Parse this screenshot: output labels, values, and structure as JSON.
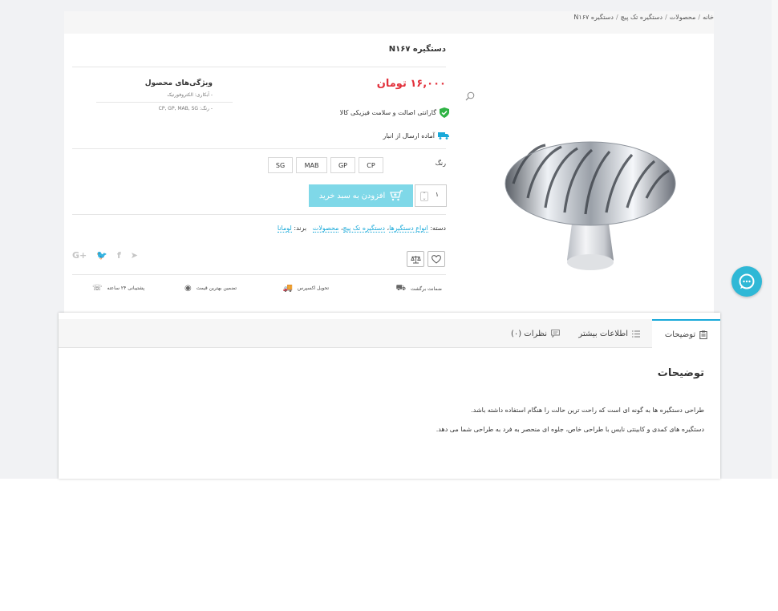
{
  "breadcrumb": {
    "items": [
      "خانه",
      "محصولات",
      "دستگیره تک پیچ",
      "دستگیره N۱۶۷"
    ],
    "separator": "/"
  },
  "product": {
    "title": "دستگیره N۱۶۷",
    "price": "۱۶,۰۰۰ تومان",
    "guarantee": "گارانتی اصالت و سلامت فیزیکی کالا",
    "ready": "آماده ارسال از انبار",
    "color_label": "رنگ",
    "colors": [
      "CP",
      "GP",
      "MAB",
      "SG"
    ],
    "quantity": "۱",
    "add_to_cart": "افزودن به سبد خرید",
    "category_label": "دسته:",
    "categories": [
      "انواع دستگیرها",
      "دستگیره تک پیچ",
      "محصولات"
    ],
    "brand_label": "برند:",
    "brand": "لومانا"
  },
  "features": {
    "title": "ویژگی‌های محصول",
    "items": [
      "- آبکاری: الکتروفورتیک",
      "- رنگ: CP, GP, MAB, SG"
    ]
  },
  "social": {
    "google": "G+",
    "twitter": "🐦",
    "facebook": "f",
    "telegram": "➤"
  },
  "benefits": [
    {
      "label": "ضمانت برگشت",
      "icon": "return-guarantee-icon"
    },
    {
      "label": "تحویل اکسپرس",
      "icon": "express-delivery-icon"
    },
    {
      "label": "تضمین بهترین قیمت",
      "icon": "best-price-icon"
    },
    {
      "label": "پشتیبانی ۲۴ ساعته",
      "icon": "support-icon"
    }
  ],
  "tabs": [
    {
      "label": "توضیحات",
      "icon": "clipboard-icon",
      "active": true
    },
    {
      "label": "اطلاعات بیشتر",
      "icon": "list-icon",
      "active": false
    },
    {
      "label": "نظرات (۰)",
      "icon": "comment-icon",
      "active": false
    }
  ],
  "description": {
    "title": "توضیحات",
    "paragraphs": [
      "طراحی دستگیره ها به گونه ای است که راحت ترین حالت را هنگام استفاده داشته باشد.",
      "دستگیره های کمدی و کابینتی نایس با طراحی خاص، جلوه ای منحصر به فرد به طراحی شما می دهد."
    ]
  },
  "colors": {
    "price": "#e2303b",
    "accent": "#19a9d9",
    "cart_button": "#7fd8e8",
    "guarantee_green": "#2fb344",
    "chat": "#2fb8d6"
  }
}
